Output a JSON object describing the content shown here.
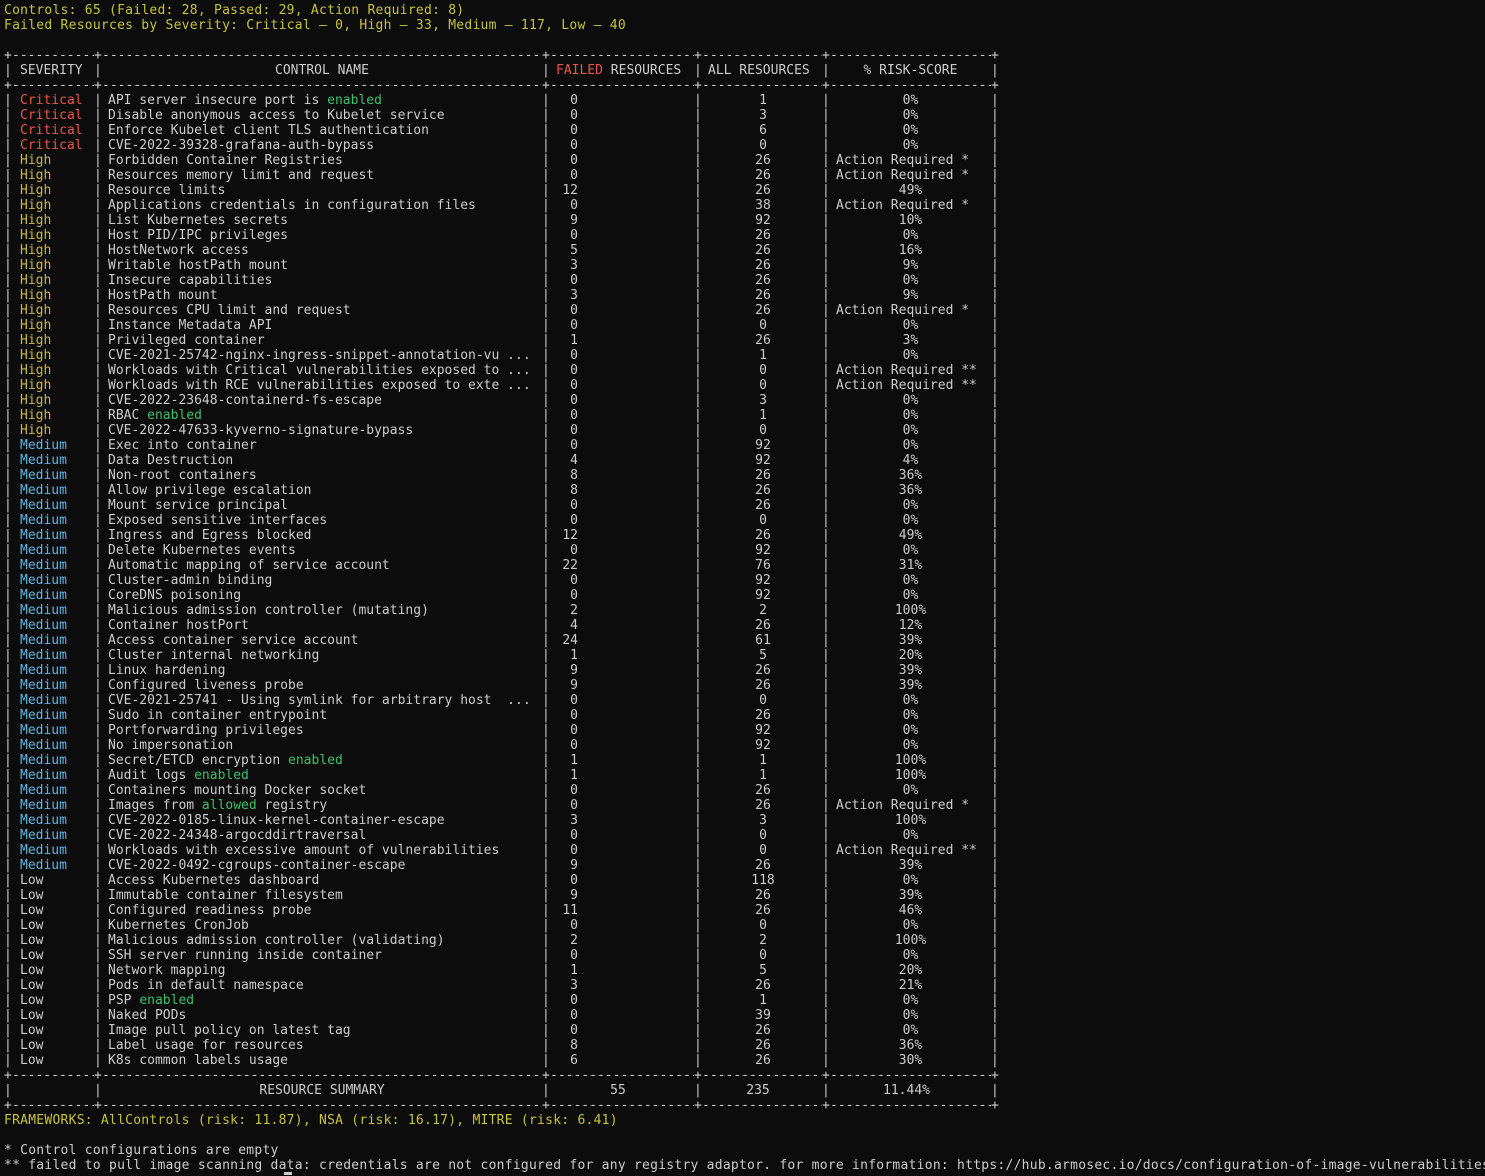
{
  "summary": {
    "controls_line": "Controls: 65 (Failed: 28, Passed: 29, Action Required: 8)",
    "severity_line": "Failed Resources by Severity: Critical — 0, High — 33, Medium — 117, Low — 40"
  },
  "table": {
    "headers": {
      "severity": "SEVERITY",
      "control_name": "CONTROL NAME",
      "failed_word": "FAILED",
      "failed_rest": " RESOURCES",
      "all_resources": "ALL RESOURCES",
      "risk_score": "% RISK-SCORE"
    },
    "colors": {
      "critical": "#e8564a",
      "high": "#ccb640",
      "medium": "#5fb6e4",
      "low": "#cccccc",
      "enabled": "#3cc16a"
    },
    "rows": [
      {
        "severity": "Critical",
        "name": "API server insecure port is ",
        "name_hl": "enabled",
        "name_tail": "",
        "failed": "0",
        "all": "1",
        "risk": "0%"
      },
      {
        "severity": "Critical",
        "name": "Disable anonymous access to Kubelet service",
        "name_hl": "",
        "name_tail": "",
        "failed": "0",
        "all": "3",
        "risk": "0%"
      },
      {
        "severity": "Critical",
        "name": "Enforce Kubelet client TLS authentication",
        "name_hl": "",
        "name_tail": "",
        "failed": "0",
        "all": "6",
        "risk": "0%"
      },
      {
        "severity": "Critical",
        "name": "CVE-2022-39328-grafana-auth-bypass",
        "name_hl": "",
        "name_tail": "",
        "failed": "0",
        "all": "0",
        "risk": "0%"
      },
      {
        "severity": "High",
        "name": "Forbidden Container Registries",
        "name_hl": "",
        "name_tail": "",
        "failed": "0",
        "all": "26",
        "risk": "Action Required *"
      },
      {
        "severity": "High",
        "name": "Resources memory limit and request",
        "name_hl": "",
        "name_tail": "",
        "failed": "0",
        "all": "26",
        "risk": "Action Required *"
      },
      {
        "severity": "High",
        "name": "Resource limits",
        "name_hl": "",
        "name_tail": "",
        "failed": "12",
        "all": "26",
        "risk": "49%"
      },
      {
        "severity": "High",
        "name": "Applications credentials in configuration files",
        "name_hl": "",
        "name_tail": "",
        "failed": "0",
        "all": "38",
        "risk": "Action Required *"
      },
      {
        "severity": "High",
        "name": "List Kubernetes secrets",
        "name_hl": "",
        "name_tail": "",
        "failed": "9",
        "all": "92",
        "risk": "10%"
      },
      {
        "severity": "High",
        "name": "Host PID/IPC privileges",
        "name_hl": "",
        "name_tail": "",
        "failed": "0",
        "all": "26",
        "risk": "0%"
      },
      {
        "severity": "High",
        "name": "HostNetwork access",
        "name_hl": "",
        "name_tail": "",
        "failed": "5",
        "all": "26",
        "risk": "16%"
      },
      {
        "severity": "High",
        "name": "Writable hostPath mount",
        "name_hl": "",
        "name_tail": "",
        "failed": "3",
        "all": "26",
        "risk": "9%"
      },
      {
        "severity": "High",
        "name": "Insecure capabilities",
        "name_hl": "",
        "name_tail": "",
        "failed": "0",
        "all": "26",
        "risk": "0%"
      },
      {
        "severity": "High",
        "name": "HostPath mount",
        "name_hl": "",
        "name_tail": "",
        "failed": "3",
        "all": "26",
        "risk": "9%"
      },
      {
        "severity": "High",
        "name": "Resources CPU limit and request",
        "name_hl": "",
        "name_tail": "",
        "failed": "0",
        "all": "26",
        "risk": "Action Required *"
      },
      {
        "severity": "High",
        "name": "Instance Metadata API",
        "name_hl": "",
        "name_tail": "",
        "failed": "0",
        "all": "0",
        "risk": "0%"
      },
      {
        "severity": "High",
        "name": "Privileged container",
        "name_hl": "",
        "name_tail": "",
        "failed": "1",
        "all": "26",
        "risk": "3%"
      },
      {
        "severity": "High",
        "name": "CVE-2021-25742-nginx-ingress-snippet-annotation-vu ...",
        "name_hl": "",
        "name_tail": "",
        "failed": "0",
        "all": "1",
        "risk": "0%"
      },
      {
        "severity": "High",
        "name": "Workloads with Critical vulnerabilities exposed to ...",
        "name_hl": "",
        "name_tail": "",
        "failed": "0",
        "all": "0",
        "risk": "Action Required **"
      },
      {
        "severity": "High",
        "name": "Workloads with RCE vulnerabilities exposed to exte ...",
        "name_hl": "",
        "name_tail": "",
        "failed": "0",
        "all": "0",
        "risk": "Action Required **"
      },
      {
        "severity": "High",
        "name": "CVE-2022-23648-containerd-fs-escape",
        "name_hl": "",
        "name_tail": "",
        "failed": "0",
        "all": "3",
        "risk": "0%"
      },
      {
        "severity": "High",
        "name": "RBAC ",
        "name_hl": "enabled",
        "name_tail": "",
        "failed": "0",
        "all": "1",
        "risk": "0%"
      },
      {
        "severity": "High",
        "name": "CVE-2022-47633-kyverno-signature-bypass",
        "name_hl": "",
        "name_tail": "",
        "failed": "0",
        "all": "0",
        "risk": "0%"
      },
      {
        "severity": "Medium",
        "name": "Exec into container",
        "name_hl": "",
        "name_tail": "",
        "failed": "0",
        "all": "92",
        "risk": "0%"
      },
      {
        "severity": "Medium",
        "name": "Data Destruction",
        "name_hl": "",
        "name_tail": "",
        "failed": "4",
        "all": "92",
        "risk": "4%"
      },
      {
        "severity": "Medium",
        "name": "Non-root containers",
        "name_hl": "",
        "name_tail": "",
        "failed": "8",
        "all": "26",
        "risk": "36%"
      },
      {
        "severity": "Medium",
        "name": "Allow privilege escalation",
        "name_hl": "",
        "name_tail": "",
        "failed": "8",
        "all": "26",
        "risk": "36%"
      },
      {
        "severity": "Medium",
        "name": "Mount service principal",
        "name_hl": "",
        "name_tail": "",
        "failed": "0",
        "all": "26",
        "risk": "0%"
      },
      {
        "severity": "Medium",
        "name": "Exposed sensitive interfaces",
        "name_hl": "",
        "name_tail": "",
        "failed": "0",
        "all": "0",
        "risk": "0%"
      },
      {
        "severity": "Medium",
        "name": "Ingress and Egress blocked",
        "name_hl": "",
        "name_tail": "",
        "failed": "12",
        "all": "26",
        "risk": "49%"
      },
      {
        "severity": "Medium",
        "name": "Delete Kubernetes events",
        "name_hl": "",
        "name_tail": "",
        "failed": "0",
        "all": "92",
        "risk": "0%"
      },
      {
        "severity": "Medium",
        "name": "Automatic mapping of service account",
        "name_hl": "",
        "name_tail": "",
        "failed": "22",
        "all": "76",
        "risk": "31%"
      },
      {
        "severity": "Medium",
        "name": "Cluster-admin binding",
        "name_hl": "",
        "name_tail": "",
        "failed": "0",
        "all": "92",
        "risk": "0%"
      },
      {
        "severity": "Medium",
        "name": "CoreDNS poisoning",
        "name_hl": "",
        "name_tail": "",
        "failed": "0",
        "all": "92",
        "risk": "0%"
      },
      {
        "severity": "Medium",
        "name": "Malicious admission controller (mutating)",
        "name_hl": "",
        "name_tail": "",
        "failed": "2",
        "all": "2",
        "risk": "100%"
      },
      {
        "severity": "Medium",
        "name": "Container hostPort",
        "name_hl": "",
        "name_tail": "",
        "failed": "4",
        "all": "26",
        "risk": "12%"
      },
      {
        "severity": "Medium",
        "name": "Access container service account",
        "name_hl": "",
        "name_tail": "",
        "failed": "24",
        "all": "61",
        "risk": "39%"
      },
      {
        "severity": "Medium",
        "name": "Cluster internal networking",
        "name_hl": "",
        "name_tail": "",
        "failed": "1",
        "all": "5",
        "risk": "20%"
      },
      {
        "severity": "Medium",
        "name": "Linux hardening",
        "name_hl": "",
        "name_tail": "",
        "failed": "9",
        "all": "26",
        "risk": "39%"
      },
      {
        "severity": "Medium",
        "name": "Configured liveness probe",
        "name_hl": "",
        "name_tail": "",
        "failed": "9",
        "all": "26",
        "risk": "39%"
      },
      {
        "severity": "Medium",
        "name": "CVE-2021-25741 - Using symlink for arbitrary host  ...",
        "name_hl": "",
        "name_tail": "",
        "failed": "0",
        "all": "0",
        "risk": "0%"
      },
      {
        "severity": "Medium",
        "name": "Sudo in container entrypoint",
        "name_hl": "",
        "name_tail": "",
        "failed": "0",
        "all": "26",
        "risk": "0%"
      },
      {
        "severity": "Medium",
        "name": "Portforwarding privileges",
        "name_hl": "",
        "name_tail": "",
        "failed": "0",
        "all": "92",
        "risk": "0%"
      },
      {
        "severity": "Medium",
        "name": "No impersonation",
        "name_hl": "",
        "name_tail": "",
        "failed": "0",
        "all": "92",
        "risk": "0%"
      },
      {
        "severity": "Medium",
        "name": "Secret/ETCD encryption ",
        "name_hl": "enabled",
        "name_tail": "",
        "failed": "1",
        "all": "1",
        "risk": "100%"
      },
      {
        "severity": "Medium",
        "name": "Audit logs ",
        "name_hl": "enabled",
        "name_tail": "",
        "failed": "1",
        "all": "1",
        "risk": "100%"
      },
      {
        "severity": "Medium",
        "name": "Containers mounting Docker socket",
        "name_hl": "",
        "name_tail": "",
        "failed": "0",
        "all": "26",
        "risk": "0%"
      },
      {
        "severity": "Medium",
        "name": "Images from ",
        "name_hl": "allowed",
        "name_tail": " registry",
        "failed": "0",
        "all": "26",
        "risk": "Action Required *"
      },
      {
        "severity": "Medium",
        "name": "CVE-2022-0185-linux-kernel-container-escape",
        "name_hl": "",
        "name_tail": "",
        "failed": "3",
        "all": "3",
        "risk": "100%"
      },
      {
        "severity": "Medium",
        "name": "CVE-2022-24348-argocddirtraversal",
        "name_hl": "",
        "name_tail": "",
        "failed": "0",
        "all": "0",
        "risk": "0%"
      },
      {
        "severity": "Medium",
        "name": "Workloads with excessive amount of vulnerabilities",
        "name_hl": "",
        "name_tail": "",
        "failed": "0",
        "all": "0",
        "risk": "Action Required **"
      },
      {
        "severity": "Medium",
        "name": "CVE-2022-0492-cgroups-container-escape",
        "name_hl": "",
        "name_tail": "",
        "failed": "9",
        "all": "26",
        "risk": "39%"
      },
      {
        "severity": "Low",
        "name": "Access Kubernetes dashboard",
        "name_hl": "",
        "name_tail": "",
        "failed": "0",
        "all": "118",
        "risk": "0%"
      },
      {
        "severity": "Low",
        "name": "Immutable container filesystem",
        "name_hl": "",
        "name_tail": "",
        "failed": "9",
        "all": "26",
        "risk": "39%"
      },
      {
        "severity": "Low",
        "name": "Configured readiness probe",
        "name_hl": "",
        "name_tail": "",
        "failed": "11",
        "all": "26",
        "risk": "46%"
      },
      {
        "severity": "Low",
        "name": "Kubernetes CronJob",
        "name_hl": "",
        "name_tail": "",
        "failed": "0",
        "all": "0",
        "risk": "0%"
      },
      {
        "severity": "Low",
        "name": "Malicious admission controller (validating)",
        "name_hl": "",
        "name_tail": "",
        "failed": "2",
        "all": "2",
        "risk": "100%"
      },
      {
        "severity": "Low",
        "name": "SSH server running inside container",
        "name_hl": "",
        "name_tail": "",
        "failed": "0",
        "all": "0",
        "risk": "0%"
      },
      {
        "severity": "Low",
        "name": "Network mapping",
        "name_hl": "",
        "name_tail": "",
        "failed": "1",
        "all": "5",
        "risk": "20%"
      },
      {
        "severity": "Low",
        "name": "Pods in default namespace",
        "name_hl": "",
        "name_tail": "",
        "failed": "3",
        "all": "26",
        "risk": "21%"
      },
      {
        "severity": "Low",
        "name": "PSP ",
        "name_hl": "enabled",
        "name_tail": "",
        "failed": "0",
        "all": "1",
        "risk": "0%"
      },
      {
        "severity": "Low",
        "name": "Naked PODs",
        "name_hl": "",
        "name_tail": "",
        "failed": "0",
        "all": "39",
        "risk": "0%"
      },
      {
        "severity": "Low",
        "name": "Image pull policy on latest tag",
        "name_hl": "",
        "name_tail": "",
        "failed": "0",
        "all": "26",
        "risk": "0%"
      },
      {
        "severity": "Low",
        "name": "Label usage for resources",
        "name_hl": "",
        "name_tail": "",
        "failed": "8",
        "all": "26",
        "risk": "36%"
      },
      {
        "severity": "Low",
        "name": "K8s common labels usage",
        "name_hl": "",
        "name_tail": "",
        "failed": "6",
        "all": "26",
        "risk": "30%"
      }
    ],
    "footer": {
      "label": "RESOURCE SUMMARY",
      "failed": "55",
      "all": "235",
      "risk": "11.44%"
    }
  },
  "frameworks_line": "FRAMEWORKS: AllControls (risk: 11.87), NSA (risk: 16.17), MITRE (risk: 6.41)",
  "notes": {
    "note1": "* Control configurations are empty",
    "note2": "** failed to pull image scanning data: credentials are not configured for any registry adaptor. for more information: https://hub.armosec.io/docs/configuration-of-image-vulnerabilities"
  }
}
